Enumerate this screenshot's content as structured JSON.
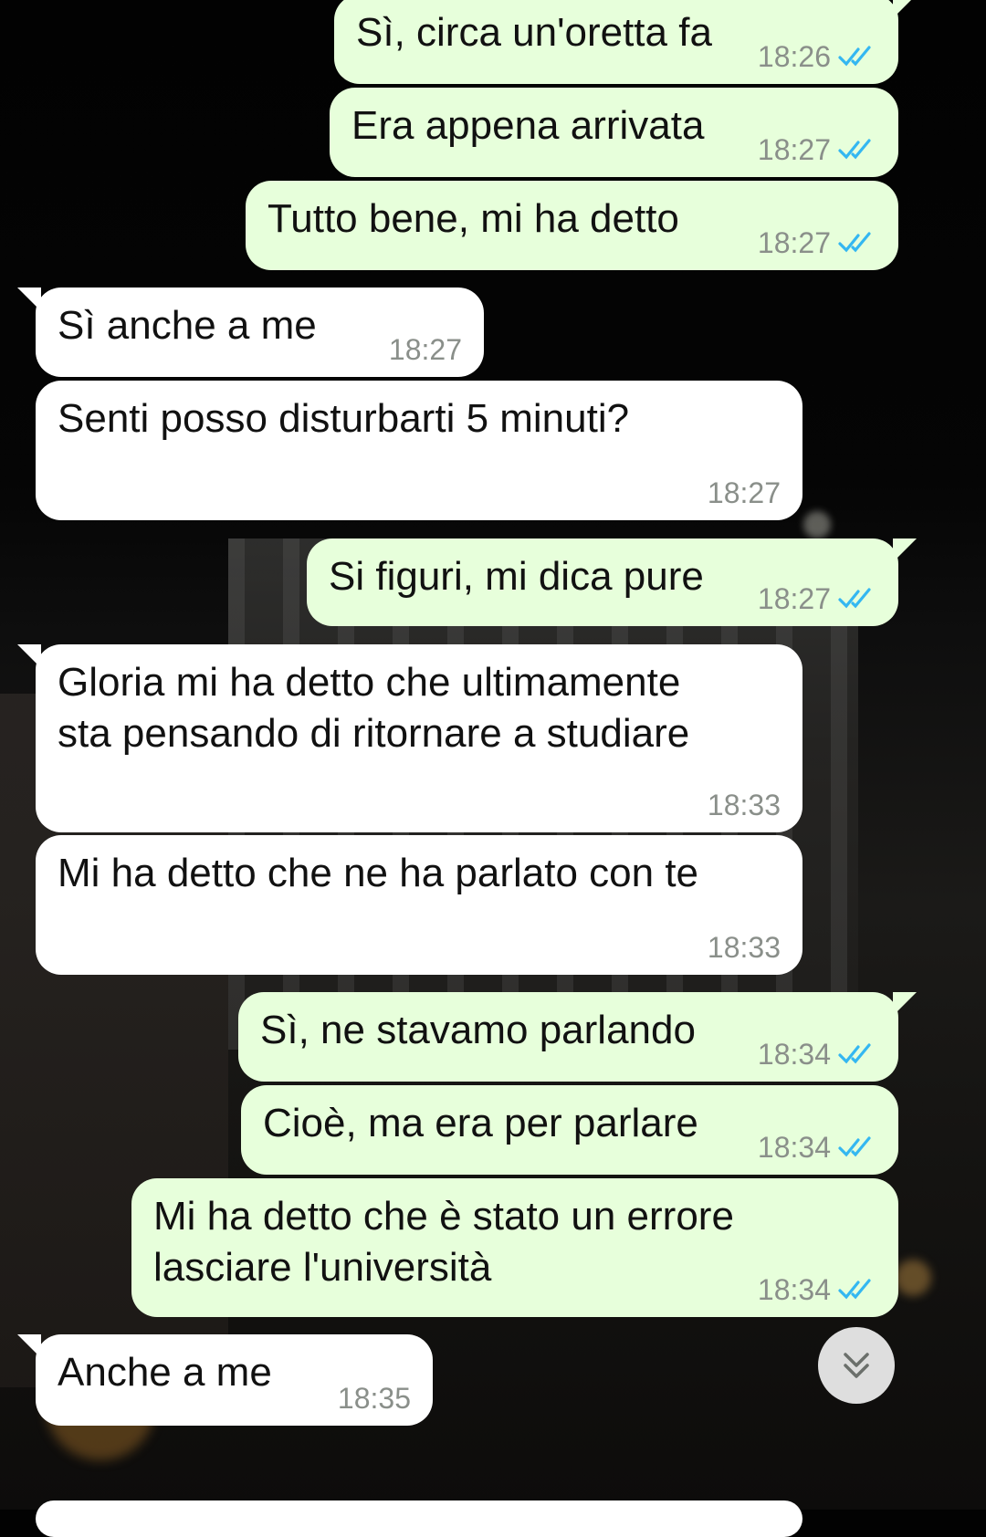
{
  "messages": [
    {
      "dir": "out",
      "text": "Sì, circa un'oretta fa",
      "time": "18:26"
    },
    {
      "dir": "out",
      "text": "Era appena arrivata",
      "time": "18:27"
    },
    {
      "dir": "out",
      "text": "Tutto bene, mi ha detto",
      "time": "18:27"
    },
    {
      "dir": "in",
      "text": "Sì anche a me",
      "time": "18:27"
    },
    {
      "dir": "in",
      "text": "Senti posso disturbarti 5 minuti?",
      "time": "18:27"
    },
    {
      "dir": "out",
      "text": "Si figuri, mi dica pure",
      "time": "18:27"
    },
    {
      "dir": "in",
      "text": "Gloria mi ha detto che ultimamente\nsta pensando di ritornare a studiare",
      "time": "18:33"
    },
    {
      "dir": "in",
      "text": "Mi ha detto che ne ha parlato con te",
      "time": "18:33"
    },
    {
      "dir": "out",
      "text": "Sì, ne stavamo parlando",
      "time": "18:34"
    },
    {
      "dir": "out",
      "text": "Cioè, ma era per parlare",
      "time": "18:34"
    },
    {
      "dir": "out",
      "text": "Mi ha detto che è stato un errore\nlasciare l'università",
      "time": "18:34"
    },
    {
      "dir": "in",
      "text": "Anche a me",
      "time": "18:35"
    }
  ],
  "icons": {
    "read_receipt": "double-check-icon",
    "scroll_down": "chevron-double-down-icon"
  },
  "colors": {
    "outgoing_bubble": "#e7ffdb",
    "incoming_bubble": "#ffffff",
    "read_ticks": "#34b7f1",
    "timestamp": "#8a8f8a"
  }
}
